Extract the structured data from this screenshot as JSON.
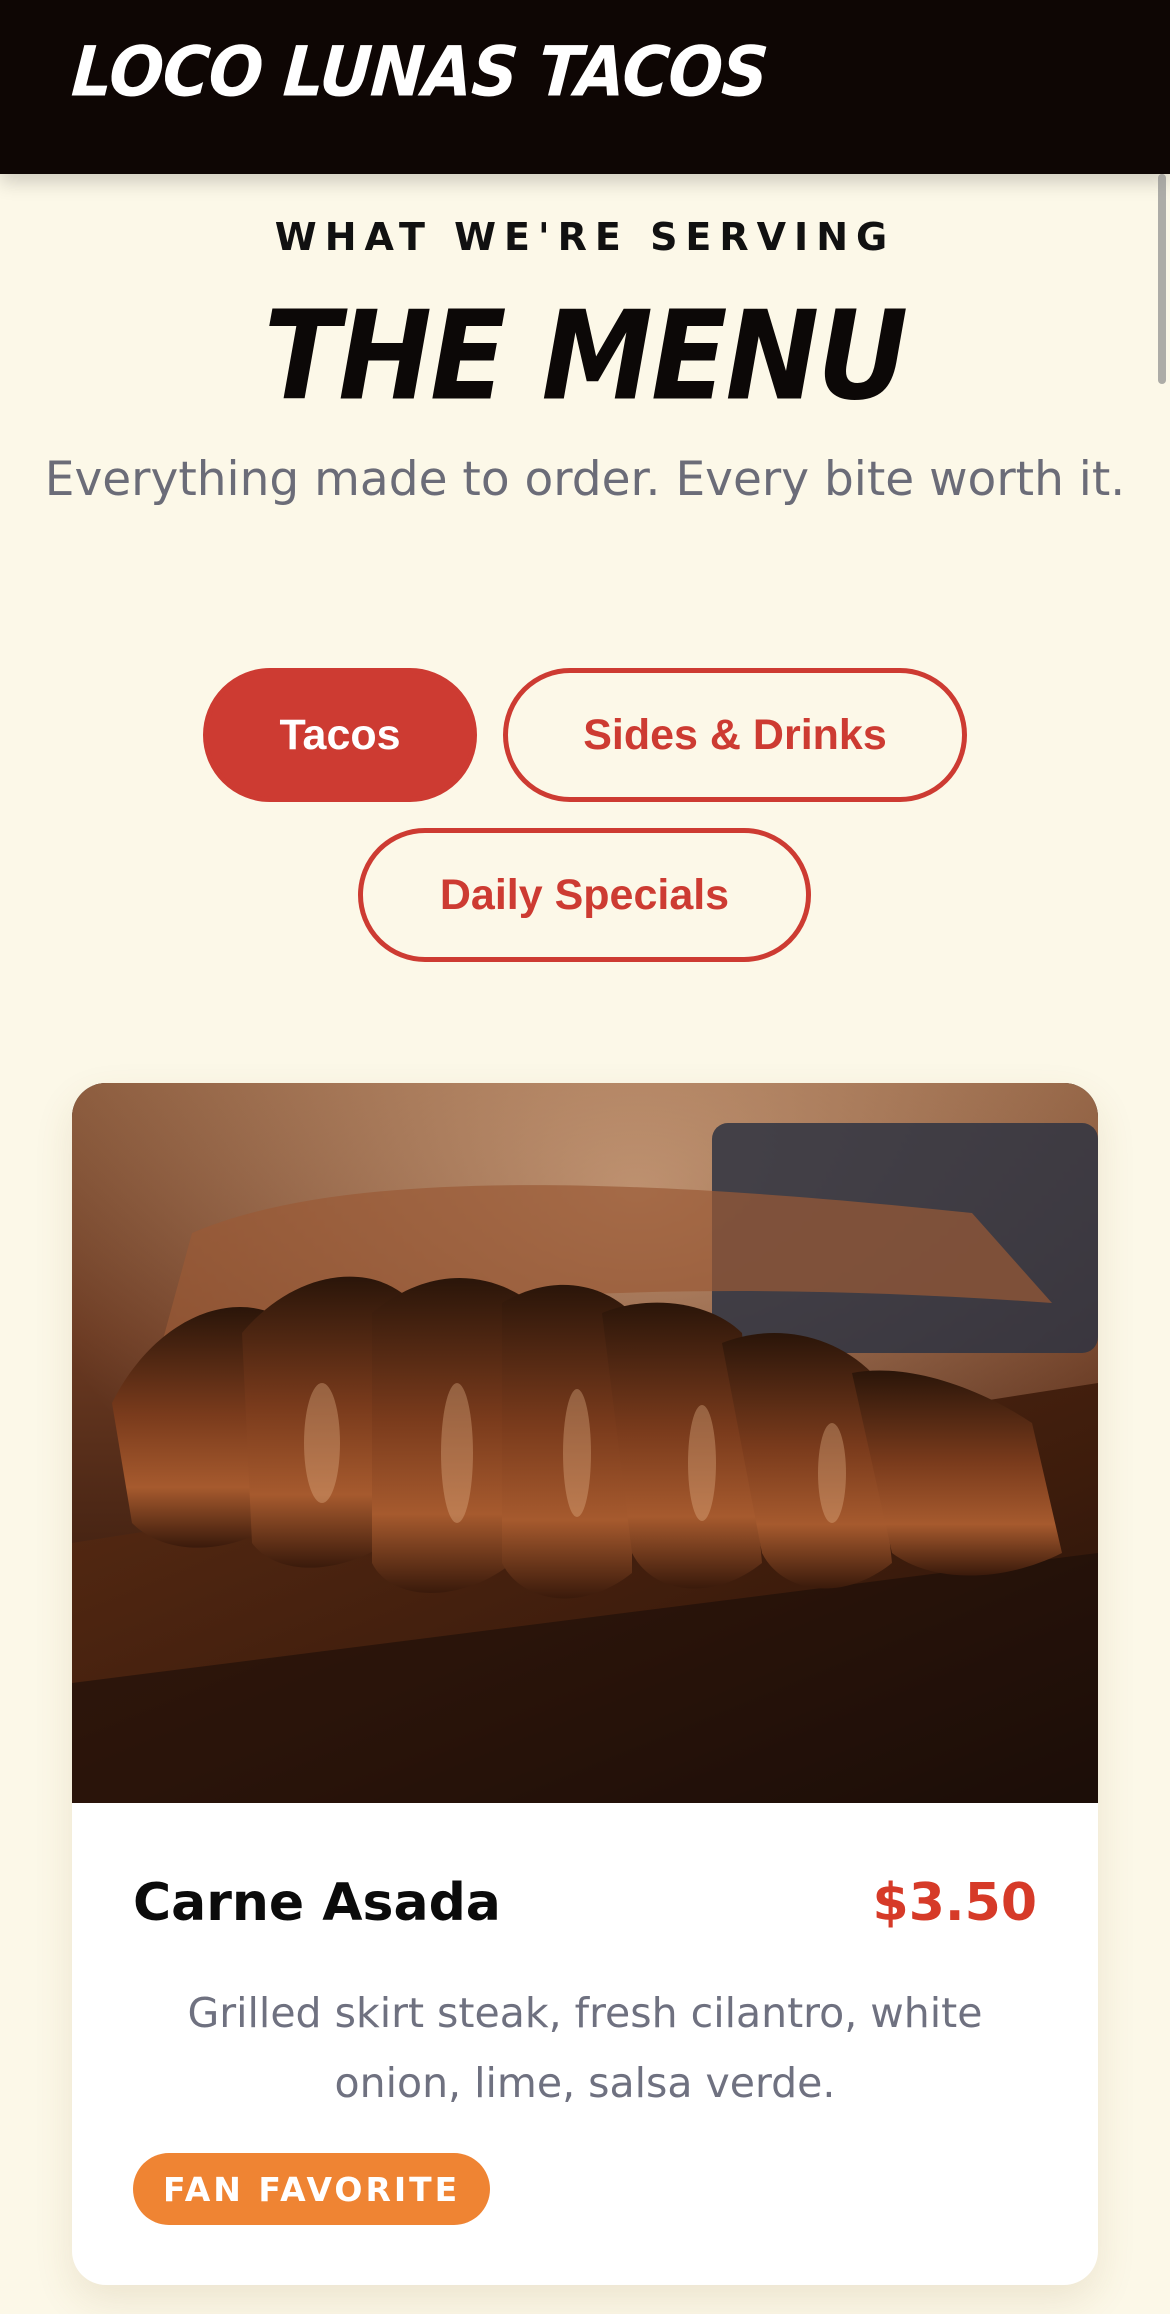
{
  "header": {
    "logo_text": "LOCO LUNAS TACOS"
  },
  "hero": {
    "eyebrow": "WHAT WE'RE SERVING",
    "title": "THE MENU",
    "subtitle": "Everything made to order. Every bite worth it."
  },
  "tabs": [
    {
      "label": "Tacos",
      "active": true
    },
    {
      "label": "Sides & Drinks",
      "active": false
    },
    {
      "label": "Daily Specials",
      "active": false
    }
  ],
  "menu_item": {
    "name": "Carne Asada",
    "price": "$3.50",
    "description": "Grilled skirt steak, fresh cilantro, white onion, lime, salsa verde.",
    "badge": "FAN FAVORITE",
    "photo": "grilled-steak-photo"
  },
  "colors": {
    "page_background": "#fcf8e8",
    "header_background": "#0e0604",
    "accent_red": "#cd3b32",
    "price_red": "#d63a28",
    "badge_orange": "#ef8433",
    "muted_text": "#6b6c78"
  }
}
